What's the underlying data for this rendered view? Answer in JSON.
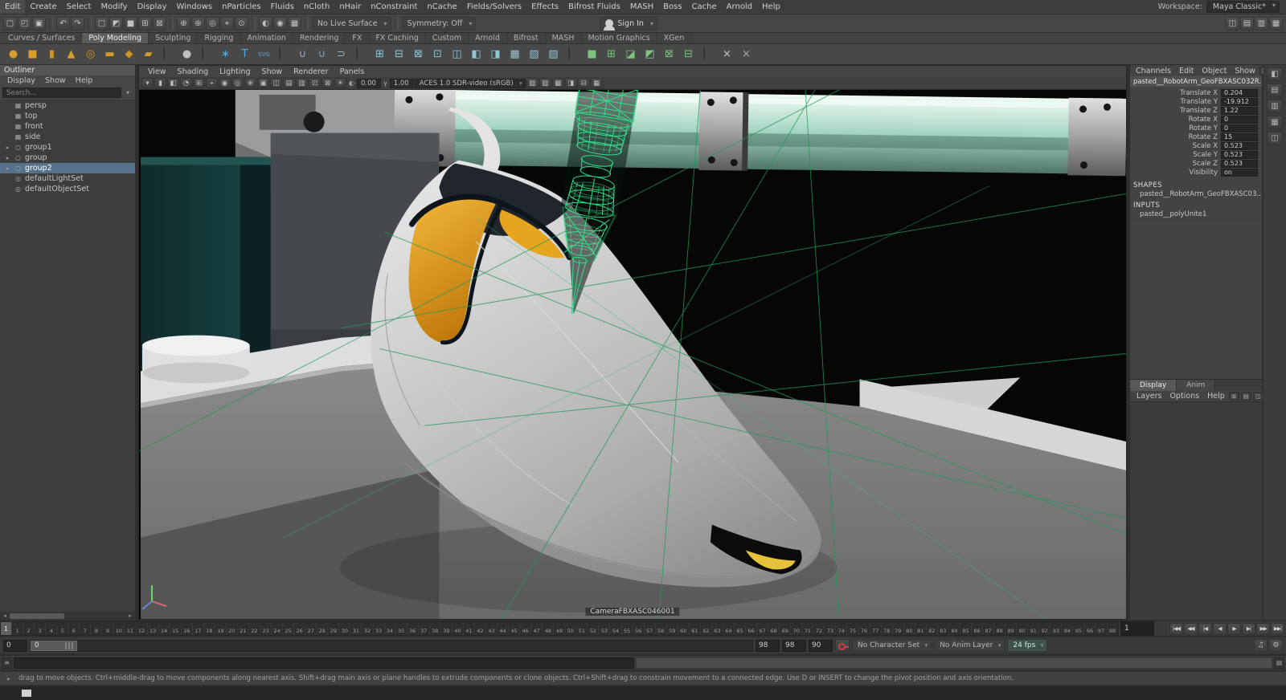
{
  "menubar": {
    "items": [
      "Edit",
      "Create",
      "Select",
      "Modify",
      "Display",
      "Windows",
      "nParticles",
      "Fluids",
      "nCloth",
      "nHair",
      "nConstraint",
      "nCache",
      "Fields/Solvers",
      "Effects",
      "Bifrost Fluids",
      "MASH",
      "Boss",
      "Cache",
      "Arnold",
      "Help"
    ],
    "workspace_label": "Workspace:",
    "workspace_value": "Maya Classic*"
  },
  "statusline": {
    "file_icons": [
      "▢",
      "◰",
      "▣"
    ],
    "undo_icons": [
      "↶",
      "↷"
    ],
    "select_icons": [
      "□",
      "◩",
      "■",
      "⊞",
      "⊠"
    ],
    "snap_icons": [
      "⊕",
      "⊛",
      "◎",
      "⌖",
      "⊙"
    ],
    "render_icons": [
      "◐",
      "◉",
      "▦"
    ],
    "live_surface": "No Live Surface",
    "symmetry_label": "Symmetry: Off",
    "signin_label": "Sign In",
    "right_icons": [
      "◫",
      "▤",
      "▥",
      "▦"
    ]
  },
  "shelf": {
    "tabs": [
      {
        "label": "Curves / Surfaces"
      },
      {
        "label": "Poly Modeling",
        "active": true
      },
      {
        "label": "Sculpting"
      },
      {
        "label": "Rigging"
      },
      {
        "label": "Animation"
      },
      {
        "label": "Rendering"
      },
      {
        "label": "FX"
      },
      {
        "label": "FX Caching"
      },
      {
        "label": "Custom"
      },
      {
        "label": "Arnold"
      },
      {
        "label": "Bifrost"
      },
      {
        "label": "MASH"
      },
      {
        "label": "Motion Graphics"
      },
      {
        "label": "XGen"
      }
    ],
    "icons": [
      {
        "g": "●",
        "c": "#d79c2e"
      },
      {
        "g": "■",
        "c": "#d79c2e"
      },
      {
        "g": "▮",
        "c": "#cf9428"
      },
      {
        "g": "▲",
        "c": "#d79c2e"
      },
      {
        "g": "◎",
        "c": "#cf9428"
      },
      {
        "g": "▬",
        "c": "#d79c2e"
      },
      {
        "g": "◆",
        "c": "#cf9428"
      },
      {
        "g": "▰",
        "c": "#d79c2e"
      },
      {
        "g": "▏",
        "c": "#2e2e2e",
        "sep": true
      },
      {
        "g": "●",
        "c": "#c0c0c0"
      },
      {
        "g": "▏",
        "c": "#2e2e2e",
        "sep": true
      },
      {
        "g": "∗",
        "c": "#5aa7dc"
      },
      {
        "g": "T",
        "c": "#5aa7dc"
      },
      {
        "g": "SVG",
        "c": "#5aa7dc",
        "small": true
      },
      {
        "g": "▏",
        "c": "#2e2e2e",
        "sep": true
      },
      {
        "g": "∪",
        "c": "#9db6c4"
      },
      {
        "g": "∪",
        "c": "#8aa6b6"
      },
      {
        "g": "⊃",
        "c": "#9db6c4"
      },
      {
        "g": "▏",
        "c": "#2e2e2e",
        "sep": true
      },
      {
        "g": "⊞",
        "c": "#8fc6d8"
      },
      {
        "g": "⊟",
        "c": "#8fc6d8"
      },
      {
        "g": "⊠",
        "c": "#8fc6d8"
      },
      {
        "g": "⊡",
        "c": "#8fc6d8"
      },
      {
        "g": "◫",
        "c": "#8fc6d8"
      },
      {
        "g": "◧",
        "c": "#8fc6d8"
      },
      {
        "g": "◨",
        "c": "#8fc6d8"
      },
      {
        "g": "▦",
        "c": "#8fc6d8"
      },
      {
        "g": "▧",
        "c": "#8fc6d8"
      },
      {
        "g": "▨",
        "c": "#8fc6d8"
      },
      {
        "g": "▏",
        "c": "#2e2e2e",
        "sep": true
      },
      {
        "g": "■",
        "c": "#7cc47c"
      },
      {
        "g": "⊞",
        "c": "#7cc47c"
      },
      {
        "g": "◪",
        "c": "#7cc47c"
      },
      {
        "g": "◩",
        "c": "#7cc47c"
      },
      {
        "g": "⊠",
        "c": "#7cc47c"
      },
      {
        "g": "⊟",
        "c": "#7cc47c"
      },
      {
        "g": "▏",
        "c": "#2e2e2e",
        "sep": true
      },
      {
        "g": "×",
        "c": "#c9c9c9"
      },
      {
        "g": "×",
        "c": "#a9a9a9"
      }
    ]
  },
  "outliner": {
    "title": "Outliner",
    "menus": [
      "Display",
      "Show",
      "Help"
    ],
    "search_placeholder": "Search...",
    "items": [
      {
        "exp": "",
        "icon": "▦",
        "label": "persp"
      },
      {
        "exp": "",
        "icon": "▦",
        "label": "top"
      },
      {
        "exp": "",
        "icon": "▦",
        "label": "front"
      },
      {
        "exp": "",
        "icon": "▦",
        "label": "side"
      },
      {
        "exp": "▸",
        "icon": "○",
        "label": "group1"
      },
      {
        "exp": "▸",
        "icon": "○",
        "label": "group"
      },
      {
        "exp": "▸",
        "icon": "○",
        "label": "group2",
        "selected": true
      },
      {
        "exp": "",
        "icon": "◎",
        "label": "defaultLightSet"
      },
      {
        "exp": "",
        "icon": "◎",
        "label": "defaultObjectSet"
      }
    ]
  },
  "viewport": {
    "menus": [
      "View",
      "Shading",
      "Lighting",
      "Show",
      "Renderer",
      "Panels"
    ],
    "toolbar_icons_left": [
      "▾",
      "▮",
      "◧",
      "◔",
      "⊞",
      "⌖",
      "◉",
      "◎",
      "⊕",
      "▣",
      "◫",
      "▤",
      "▥",
      "⊡",
      "⊠",
      "☀"
    ],
    "exposure_icon": "◐",
    "exposure": "0.00",
    "gamma_icon": "γ",
    "gamma": "1.00",
    "colorspace": "ACES 1.0 SDR-video (sRGB)",
    "toolbar_icons_right": [
      "▧",
      "▨",
      "▩",
      "◨",
      "⊟",
      "▦"
    ],
    "camera_label": "CameraFBXASC046001"
  },
  "channel_box": {
    "menus": [
      "Channels",
      "Edit",
      "Object",
      "Show"
    ],
    "corner_icons": [
      "◨",
      "▣"
    ],
    "object_name": "pasted__RobotArm_GeoFBXASC032R...",
    "attributes": [
      {
        "label": "Translate X",
        "value": "0.204"
      },
      {
        "label": "Translate Y",
        "value": "-19.912"
      },
      {
        "label": "Translate Z",
        "value": "1.22"
      },
      {
        "label": "Rotate X",
        "value": "0"
      },
      {
        "label": "Rotate Y",
        "value": "0"
      },
      {
        "label": "Rotate Z",
        "value": "15"
      },
      {
        "label": "Scale X",
        "value": "0.523"
      },
      {
        "label": "Scale Y",
        "value": "0.523"
      },
      {
        "label": "Scale Z",
        "value": "0.523"
      },
      {
        "label": "Visibility",
        "value": "on"
      }
    ],
    "shapes_header": "SHAPES",
    "shapes_item": "pasted__RobotArm_GeoFBXASC03...",
    "inputs_header": "INPUTS",
    "inputs_item": "pasted__polyUnite1"
  },
  "layer_editor": {
    "tabs": [
      {
        "label": "Display",
        "active": true
      },
      {
        "label": "Anim"
      }
    ],
    "menus": [
      "Layers",
      "Options",
      "Help"
    ],
    "icons": [
      "⊞",
      "▤",
      "◫"
    ]
  },
  "sidebar": {
    "icons": [
      "◧",
      "▤",
      "▥",
      "▦",
      "◫"
    ]
  },
  "timeline": {
    "current_frame": "1",
    "time_field": "1",
    "ticks": [
      1,
      2,
      3,
      4,
      5,
      6,
      7,
      8,
      9,
      10,
      11,
      12,
      13,
      14,
      15,
      16,
      17,
      18,
      19,
      20,
      21,
      22,
      23,
      24,
      25,
      26,
      27,
      28,
      29,
      30,
      31,
      32,
      33,
      34,
      35,
      36,
      37,
      38,
      39,
      40,
      41,
      42,
      43,
      44,
      45,
      46,
      47,
      48,
      49,
      50,
      51,
      52,
      53,
      54,
      55,
      56,
      57,
      58,
      59,
      60,
      61,
      62,
      63,
      64,
      65,
      66,
      67,
      68,
      69,
      70,
      71,
      72,
      73,
      74,
      75,
      76,
      77,
      78,
      79,
      80,
      81,
      82,
      83,
      84,
      85,
      86,
      87,
      88,
      89,
      90,
      91,
      92,
      93,
      94,
      95,
      96,
      97,
      98
    ],
    "playback_buttons": [
      "|◀◀",
      "◀◀",
      "|◀",
      "◀",
      "▶",
      "▶|",
      "▶▶",
      "▶▶|"
    ]
  },
  "range_slider": {
    "anim_start": "0",
    "handle_label": "0",
    "play_end": "98",
    "anim_end": "98",
    "extra_field": "90",
    "character_set": "No Character Set",
    "anim_layer": "No Anim Layer",
    "fps": "24 fps",
    "right_icons": [
      "♫",
      "⚙"
    ]
  },
  "command_line": {
    "left_icon": "≡",
    "right_icon": "▤"
  },
  "help_line": {
    "icon": "▸",
    "text": "drag to move objects. Ctrl+middle-drag to move components along nearest axis. Shift+drag main axis or plane handles to extrude components or clone objects. Ctrl+Shift+drag to constrain movement to a connected edge. Use D or INSERT to change the pivot position and axis orientation."
  }
}
